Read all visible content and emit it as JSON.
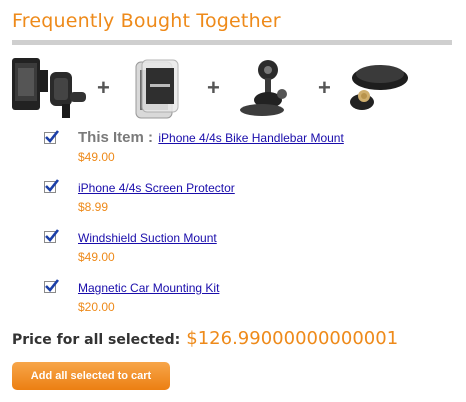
{
  "title": "Frequently Bought Together",
  "bundle_images": [
    {
      "icon": "bike-mount-product-icon"
    },
    {
      "icon": "screen-protector-product-icon"
    },
    {
      "icon": "suction-mount-product-icon"
    },
    {
      "icon": "car-mounting-kit-product-icon"
    }
  ],
  "plus_sign": "+",
  "items": [
    {
      "prefix": "This Item :",
      "name": "iPhone 4/4s Bike Handlebar Mount",
      "price": "$49.00",
      "checked": true
    },
    {
      "name": "iPhone 4/4s Screen Protector",
      "price": "$8.99",
      "checked": true
    },
    {
      "name": "Windshield Suction Mount",
      "price": "$49.00",
      "checked": true
    },
    {
      "name": "Magnetic Car Mounting Kit",
      "price": "$20.00",
      "checked": true
    }
  ],
  "total": {
    "label": "Price for all selected:",
    "value": "$126.99000000000001"
  },
  "cart_button": "Add all selected to cart",
  "colors": {
    "accent": "#ee8a1a",
    "link": "#1a0dab",
    "divider": "#cfcfcf",
    "checkbox": "#1b3fa8"
  }
}
